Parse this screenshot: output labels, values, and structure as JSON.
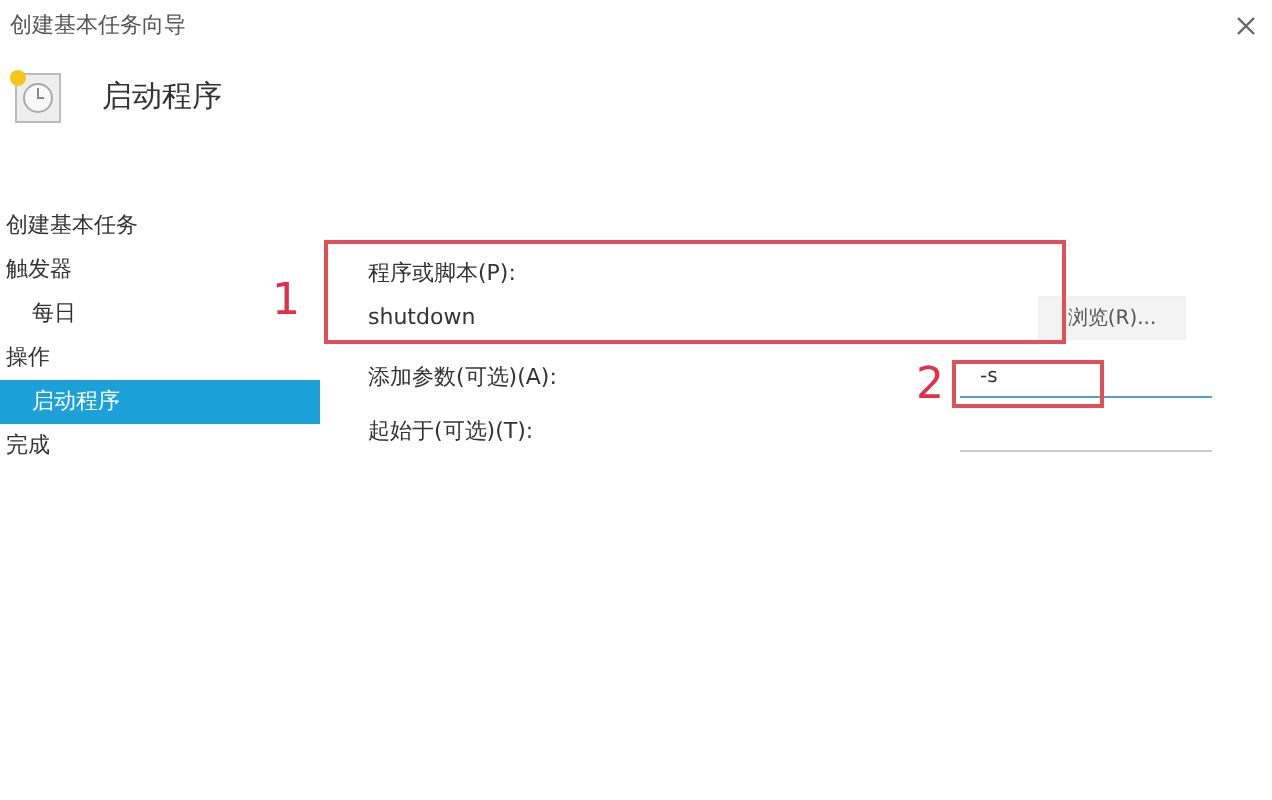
{
  "window": {
    "title": "创建基本任务向导"
  },
  "header": {
    "title": "启动程序"
  },
  "sidebar": {
    "items": [
      {
        "label": "创建基本任务",
        "selected": false
      },
      {
        "label": "触发器",
        "selected": false,
        "children": [
          {
            "label": "每日",
            "selected": false
          }
        ]
      },
      {
        "label": "操作",
        "selected": false,
        "children": [
          {
            "label": "启动程序",
            "selected": true
          }
        ]
      },
      {
        "label": "完成",
        "selected": false
      }
    ]
  },
  "form": {
    "program": {
      "label": "程序或脚本(P):",
      "value": "shutdown"
    },
    "browse_button": "浏览(R)...",
    "arguments": {
      "label": "添加参数(可选)(A):",
      "value": "-s",
      "focused": true
    },
    "start_in": {
      "label": "起始于(可选)(T):",
      "focused": false
    }
  },
  "annotations": [
    {
      "label": "1"
    },
    {
      "label": "2"
    }
  ]
}
